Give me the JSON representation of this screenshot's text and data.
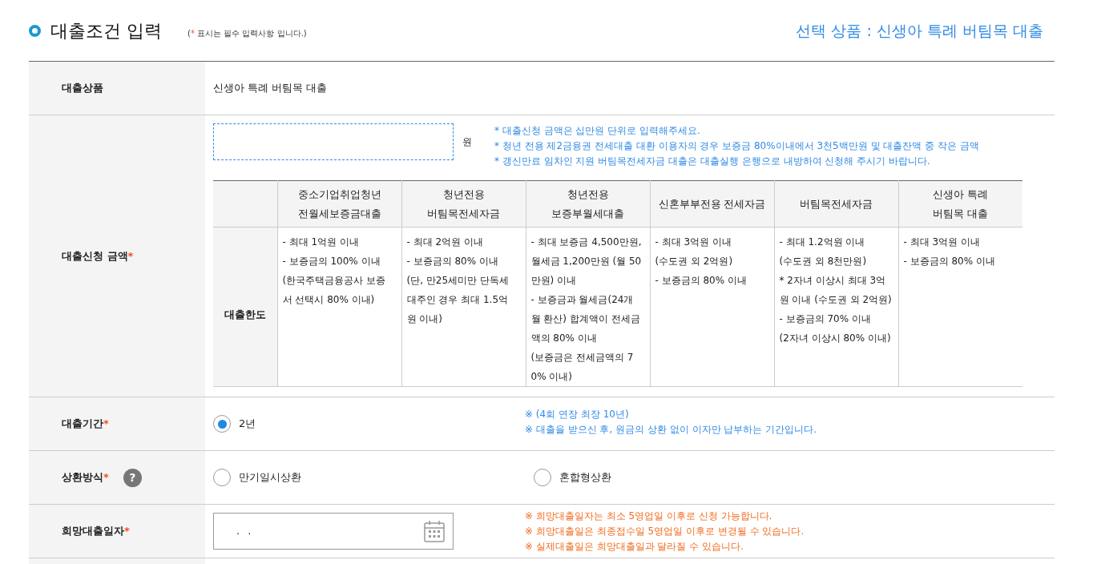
{
  "header": {
    "title": "대출조건 입력",
    "note_open": "(",
    "note_mark": "*",
    "note_text": "표시는 필수 입력사항 입니다.)",
    "selected_product": "선택 상품 : 신생아 특례 버팀목 대출"
  },
  "rows": [
    {
      "kind": "text",
      "label": "대출상품",
      "value": "신생아 특례 버팀목 대출"
    },
    {
      "kind": "amount",
      "label": "대출신청 금액",
      "mark": "*",
      "unit": "원",
      "color": "#2f8ae6",
      "notes": [
        "* 대출신청 금액은 십만원 단위로 입력해주세요.",
        "* 청년 전용 제2금융권 전세대출 대환 이용자의 경우 보증금 80%이내에서 3천5백만원 및 대출잔액 중 작은 금액",
        "* 갱신만료 임차인 지원 버팀목전세자금 대출은 대출실행 은행으로 내방하여 신청해 주시기 바랍니다."
      ],
      "limit_table": {
        "row_label": "대출한도",
        "columns": [
          {
            "heading": [
              "중소기업취업청년",
              "전월세보증금대출"
            ],
            "lines": [
              "- 최대 1억원 이내",
              "- 보증금의 100% 이내",
              "(한국주택금융공사 보증",
              "서 선택시 80% 이내)"
            ]
          },
          {
            "heading": [
              "청년전용",
              "버팀목전세자금"
            ],
            "lines": [
              "- 최대 2억원 이내",
              "- 보증금의 80% 이내",
              "(단, 만25세미만 단독세",
              "대주인 경우 최대 1.5억",
              "원 이내)"
            ]
          },
          {
            "heading": [
              "청년전용",
              "보증부월세대출"
            ],
            "lines": [
              "- 최대 보증금 4,500만원,",
              "월세금 1,200만원 (월 50",
              "만원) 이내",
              "- 보증금과 월세금(24개",
              "월 환산) 합계액이 전세금",
              "액의 80% 이내",
              "(보증금은 전세금액의 7",
              "0% 이내)"
            ]
          },
          {
            "heading": [
              "신혼부부전용 전세자금"
            ],
            "lines": [
              "- 최대 3억원 이내",
              "(수도권 외 2억원)",
              "- 보증금의 80% 이내"
            ]
          },
          {
            "heading": [
              "버팀목전세자금"
            ],
            "lines": [
              "- 최대 1.2억원 이내",
              "(수도권 외 8천만원)",
              "* 2자녀 이상시 최대 3억",
              "원 이내 (수도권 외 2억원)",
              "- 보증금의 70% 이내",
              "(2자녀 이상시 80% 이내)"
            ]
          },
          {
            "heading": [
              "신생아 특례",
              "버팀목 대출"
            ],
            "lines": [
              "- 최대 3억원 이내",
              "- 보증금의 80% 이내"
            ]
          }
        ]
      }
    },
    {
      "kind": "radio",
      "label": "대출기간",
      "mark": "*",
      "options": [
        {
          "label": "2년",
          "selected": true
        }
      ],
      "color": "#2f8ae6",
      "notes": [
        "※ (4회 연장 최장 10년)",
        "※ 대출을 받으신 후, 원금의 상환 없이 이자만 납부하는 기간입니다."
      ]
    },
    {
      "kind": "radio",
      "label": "상환방식",
      "mark": "*",
      "help": "?",
      "options": [
        {
          "label": "만기일시상환",
          "selected": false
        },
        {
          "label": "혼합형상환",
          "selected": false
        }
      ]
    },
    {
      "kind": "date",
      "label": "희망대출일자",
      "mark": "*",
      "value": ". .",
      "color": "#f26b1d",
      "notes": [
        "※ 희망대출일자는 최소 5영업일 이후로 신청 가능합니다.",
        "※ 희망대출일은 최종접수일 5영업일 이후로 변경될 수 있습니다.",
        "※ 실제대출일은 희망대출일과 달라질 수 있습니다."
      ]
    },
    {
      "kind": "partial"
    }
  ]
}
